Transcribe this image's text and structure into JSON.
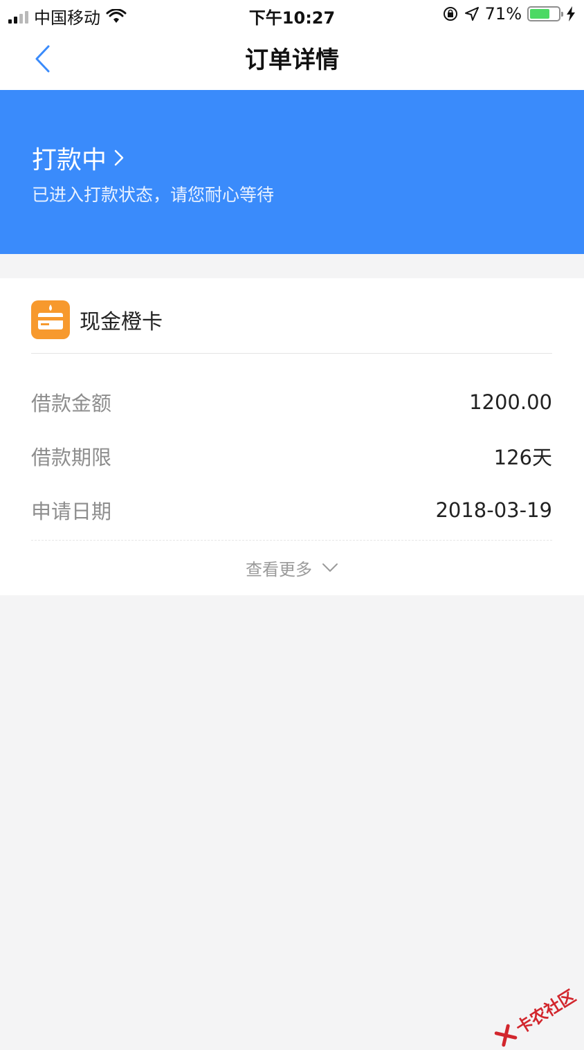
{
  "status_bar": {
    "carrier": "中国移动",
    "time": "下午10:27",
    "battery_percent": "71%",
    "battery_level": 0.71
  },
  "nav": {
    "title": "订单详情"
  },
  "banner": {
    "title": "打款中",
    "subtitle": "已进入打款状态，请您耐心等待",
    "background_color": "#3a8bfb"
  },
  "card": {
    "app_name": "现金橙卡",
    "logo_color": "#f7992d",
    "rows": [
      {
        "label": "借款金额",
        "value": "1200.00"
      },
      {
        "label": "借款期限",
        "value": "126天"
      },
      {
        "label": "申请日期",
        "value": "2018-03-19"
      }
    ],
    "more_label": "查看更多"
  },
  "watermark": {
    "text": "卡农社区"
  }
}
